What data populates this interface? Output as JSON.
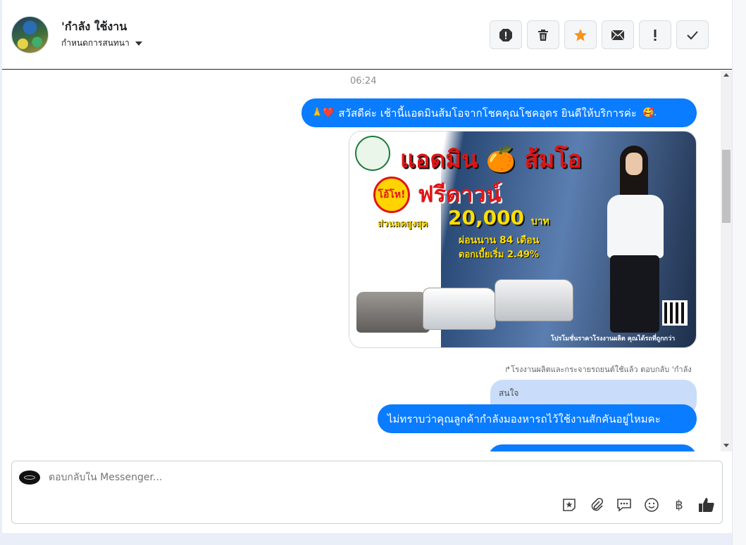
{
  "header": {
    "contact_name": "'กำลัง ใช้งาน",
    "subtitle": "กำหนดการสนทนา",
    "actions": [
      {
        "name": "report-icon"
      },
      {
        "name": "trash-icon"
      },
      {
        "name": "star-icon",
        "color": "#f7941d"
      },
      {
        "name": "envelope-icon"
      },
      {
        "name": "exclamation-icon"
      },
      {
        "name": "check-icon"
      }
    ]
  },
  "conversation": {
    "timestamp": "06:24",
    "greeting": {
      "emoji_prefix": "🙏❤️",
      "text": "สวัสดีค่ะ เช้านี้แอดมินส้มโอจากโชคคุณโชคอุดร ยินดีให้บริการค่ะ",
      "emoji_suffix": "🥰."
    },
    "promo": {
      "title": "แอดมิน 🍊 ส้มโอ",
      "badge": "โอ้โห!",
      "headline": "ฟรีดาวน์",
      "discount_label": "ส่วนลดสูงสุด",
      "amount": "20,000",
      "currency": "บาท",
      "term": "ผ่อนนาน 84 เดือน",
      "rate": "ดอกเบี้ยเริ่ม 2.49%",
      "footer": "โปรโมชั่นราคาโรงงานผลิต คุณได้รถที่ถูกกว่า"
    },
    "forward_note": "↱โรงงานผลิตและกระจายรถยนต์ใช้แล้ว ตอบกลับ 'กำลัง",
    "quoted": "สนใจ",
    "reply": "ไม่ทราบว่าคุณลูกค้ากำลังมองหารถไว้ใช้งานสักคันอยู่ไหมคะ"
  },
  "composer": {
    "placeholder": "ตอบกลับใน Messenger...",
    "tools": [
      "sticker-icon",
      "attachment-icon",
      "saved-reply-icon",
      "emoji-icon",
      "baht-icon",
      "thumbs-up-icon"
    ],
    "baht_symbol": "฿"
  }
}
